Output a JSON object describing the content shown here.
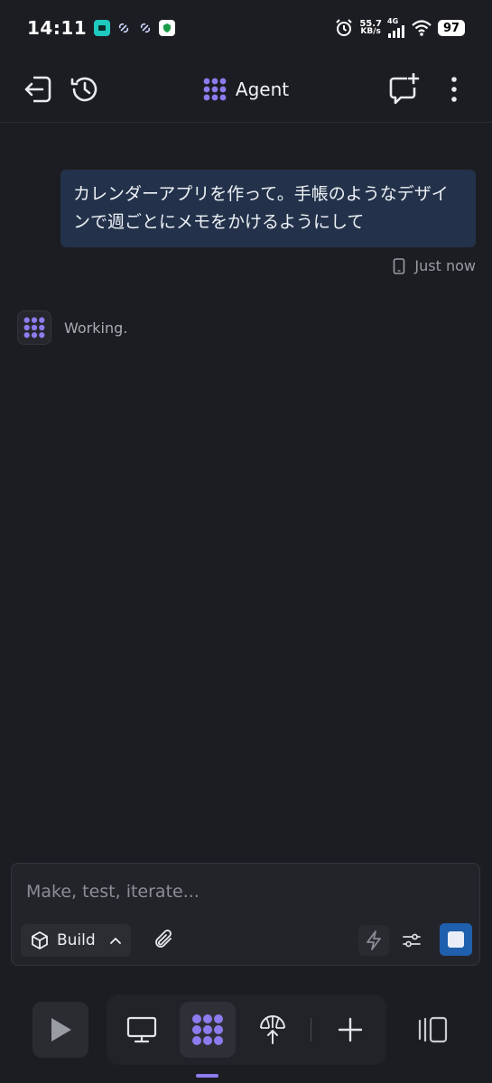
{
  "status_bar": {
    "time": "14:11",
    "net_speed_value": "55.7",
    "net_speed_unit": "KB/s",
    "network_type": "4G",
    "battery": "97"
  },
  "header": {
    "title": "Agent"
  },
  "chat": {
    "user_message": "カレンダーアプリを作って。手帳のようなデザインで週ごとにメモをかけるようにして",
    "timestamp": "Just now",
    "agent_status": "Working."
  },
  "composer": {
    "placeholder": "Make, test, iterate...",
    "mode_label": "Build"
  },
  "colors": {
    "accent_purple": "#8b7cf0",
    "stop_blue": "#1f5fae",
    "user_bubble": "#23324a"
  },
  "icons": {
    "header_left": [
      "exit-icon",
      "history-icon"
    ],
    "header_right": [
      "new-chat-icon",
      "more-vert-icon"
    ],
    "bottom_nav": [
      "play-icon",
      "monitor-icon",
      "agent-icon",
      "deploy-icon",
      "plus-icon",
      "panel-icon"
    ]
  }
}
